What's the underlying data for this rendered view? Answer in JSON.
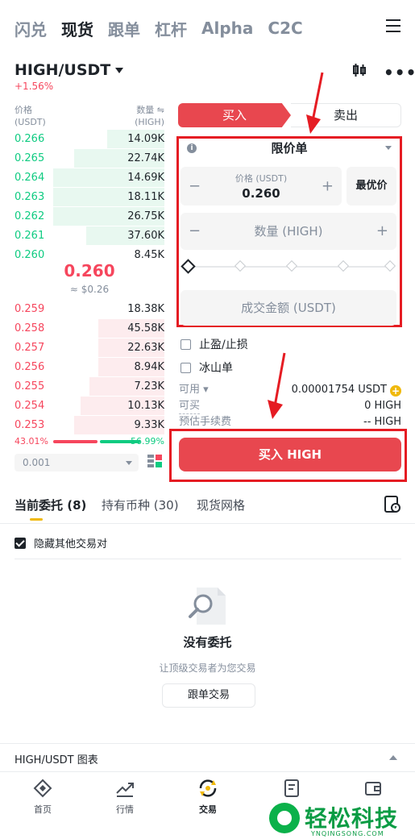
{
  "topnav": {
    "tabs": [
      "闪兑",
      "现货",
      "跟单",
      "杠杆",
      "Alpha",
      "C2C"
    ],
    "active": "现货"
  },
  "pair": {
    "name": "HIGH/USDT",
    "change": "+1.56%"
  },
  "orderbook": {
    "price_header": "价格",
    "price_unit": "(USDT)",
    "qty_header": "数量 ⇋",
    "qty_unit": "(HIGH)",
    "bids": [
      {
        "price": "0.266",
        "qty": "14.09K",
        "depth": 0.38
      },
      {
        "price": "0.265",
        "qty": "22.74K",
        "depth": 0.6
      },
      {
        "price": "0.264",
        "qty": "14.69K",
        "depth": 0.74
      },
      {
        "price": "0.263",
        "qty": "18.11K",
        "depth": 0.74
      },
      {
        "price": "0.262",
        "qty": "26.75K",
        "depth": 0.74
      },
      {
        "price": "0.261",
        "qty": "37.60K",
        "depth": 0.52
      },
      {
        "price": "0.260",
        "qty": "8.45K",
        "depth": 0.0
      }
    ],
    "mid_price": "0.260",
    "mid_usd": "≈ $0.26",
    "asks": [
      {
        "price": "0.259",
        "qty": "18.38K",
        "depth": 0.0
      },
      {
        "price": "0.258",
        "qty": "45.58K",
        "depth": 0.44
      },
      {
        "price": "0.257",
        "qty": "22.63K",
        "depth": 0.44
      },
      {
        "price": "0.256",
        "qty": "8.94K",
        "depth": 0.44
      },
      {
        "price": "0.255",
        "qty": "7.23K",
        "depth": 0.5
      },
      {
        "price": "0.254",
        "qty": "10.13K",
        "depth": 0.56
      },
      {
        "price": "0.253",
        "qty": "9.33K",
        "depth": 0.6
      }
    ],
    "buy_ratio": "43.01%",
    "sell_ratio": "56.99%",
    "precision": "0.001"
  },
  "order_form": {
    "buy_tab": "买入",
    "sell_tab": "卖出",
    "order_type": "限价单",
    "price_label": "价格 (USDT)",
    "price_value": "0.260",
    "best_price": "最优价",
    "qty_placeholder": "数量 (HIGH)",
    "total_placeholder": "成交金额 (USDT)",
    "tp_sl": "止盈/止损",
    "iceberg": "冰山单",
    "available_label": "可用",
    "available_value": "0.00001754 USDT",
    "can_buy_label": "可买",
    "can_buy_value": "0 HIGH",
    "fee_label": "预估手续费",
    "fee_value": "-- HIGH",
    "buy_button": "买入 HIGH"
  },
  "lower": {
    "tabs": [
      "当前委托 (8)",
      "持有币种 (30)",
      "现货网格"
    ],
    "hide_other": "隐藏其他交易对",
    "empty_title": "没有委托",
    "empty_sub": "让顶级交易者为您交易",
    "copy_button": "跟单交易",
    "chart_label": "HIGH/USDT 图表"
  },
  "bottomnav": [
    "首页",
    "行情",
    "交易",
    "",
    ""
  ],
  "watermark": {
    "text": "轻松科技",
    "sub": "YNQINGSONG.COM"
  },
  "colors": {
    "buy": "#e8474f",
    "green": "#0ecb81",
    "red": "#f6465d",
    "highlight": "#e51c23",
    "accent": "#f0b90b"
  }
}
